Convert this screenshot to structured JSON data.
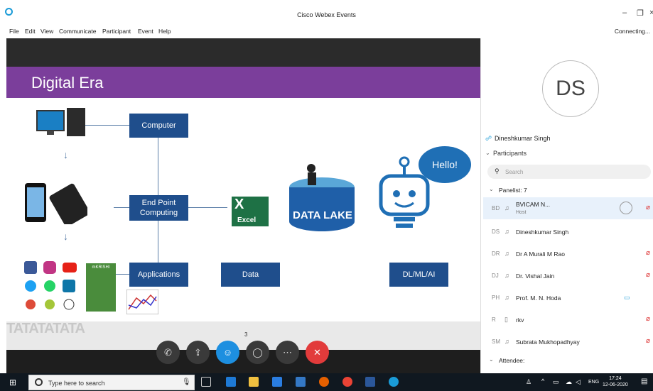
{
  "window": {
    "title": "Cisco Webex Events",
    "status": "Connecting..."
  },
  "menu": [
    "File",
    "Edit",
    "View",
    "Communicate",
    "Participant",
    "Event",
    "Help"
  ],
  "slide": {
    "title": "Digital Era",
    "boxes": {
      "computer": "Computer",
      "endpoint": "End Point Computing",
      "applications": "Applications",
      "data": "Data",
      "dlmlai": "DL/ML/AI"
    },
    "excel_label": "Excel",
    "datalake_label": "DATA LAKE",
    "hello": "Hello!",
    "app_label": "mKRISHI",
    "watermark": "TATATATATA"
  },
  "page_number": "3",
  "controls": [
    "phone-icon",
    "share-icon",
    "participants-icon",
    "chat-icon",
    "more-icon",
    "leave-icon"
  ],
  "panel": {
    "avatar_initials": "DS",
    "me_name": "Dineshkumar Singh",
    "participants_header": "Participants",
    "search_placeholder": "Search",
    "panelists_header": "Panelist: 7",
    "panelists": [
      {
        "initials": "BD",
        "name": "BVICAM N...",
        "role": "Host"
      },
      {
        "initials": "DS",
        "name": "Dineshkumar Singh",
        "role": ""
      },
      {
        "initials": "DR",
        "name": "Dr A Murali M Rao",
        "role": ""
      },
      {
        "initials": "DJ",
        "name": "Dr. Vishal Jain",
        "role": ""
      },
      {
        "initials": "PH",
        "name": "Prof. M. N. Hoda",
        "role": ""
      },
      {
        "initials": "R",
        "name": "rkv",
        "role": ""
      },
      {
        "initials": "SM",
        "name": "Subrata Mukhopadhyay",
        "role": ""
      }
    ],
    "attendee_header": "Attendee:"
  },
  "taskbar": {
    "search_text": "Type here to search",
    "lang": "ENG",
    "time": "17:24",
    "date": "12-06-2020"
  }
}
